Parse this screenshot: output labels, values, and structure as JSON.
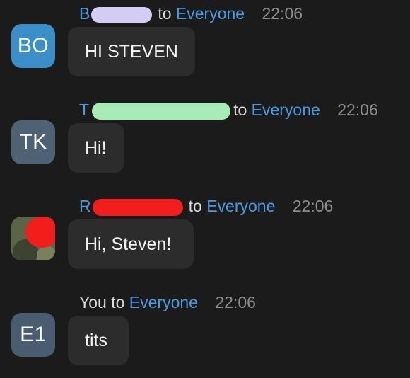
{
  "messages": [
    {
      "avatar_initials": "BO",
      "sender_visible": "B",
      "to_label": "to",
      "target": "Everyone",
      "time": "22:06",
      "text": "HI STEVEN"
    },
    {
      "avatar_initials": "TK",
      "sender_visible": "T",
      "to_label": "to",
      "target": "Everyone",
      "time": "22:06",
      "text": "Hi!"
    },
    {
      "avatar_initials": "",
      "sender_visible": "R",
      "to_label": "to",
      "target": "Everyone",
      "time": "22:06",
      "text": "Hi, Steven!"
    },
    {
      "avatar_initials": "E1",
      "sender_visible": "You",
      "to_label": "to",
      "target": "Everyone",
      "time": "22:06",
      "text": "tits"
    }
  ],
  "colors": {
    "background": "#1b1b1b",
    "bubble": "#2c2c2c",
    "accent": "#4b9be0",
    "avatar_blue": "#3a8fc8",
    "avatar_slate": "#4f6274",
    "redaction_lavender": "#d4ccf2",
    "redaction_green": "#a6ecb4",
    "redaction_red": "#f21d1d"
  }
}
